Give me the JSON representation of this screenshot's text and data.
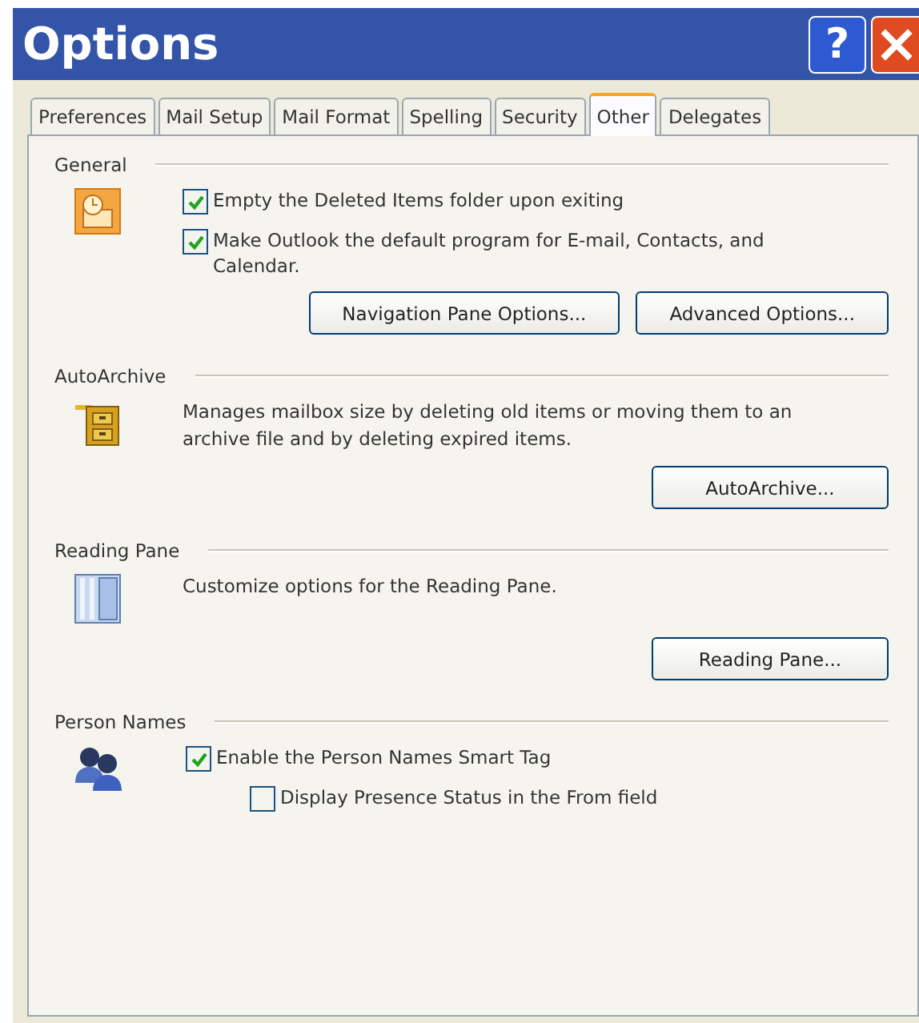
{
  "window": {
    "title": "Options",
    "help_button": "?"
  },
  "tabs": [
    {
      "label": "Preferences",
      "selected": false
    },
    {
      "label": "Mail Setup",
      "selected": false
    },
    {
      "label": "Mail Format",
      "selected": false
    },
    {
      "label": "Spelling",
      "selected": false
    },
    {
      "label": "Security",
      "selected": false
    },
    {
      "label": "Other",
      "selected": true
    },
    {
      "label": "Delegates",
      "selected": false
    }
  ],
  "sections": [
    {
      "title": "General",
      "items": [
        {
          "kind": "checkbox",
          "label": "Empty the Deleted Items folder upon exiting",
          "checked": true
        },
        {
          "kind": "checkbox",
          "label": "Make Outlook the default program for E-mail, Contacts, and Calendar.",
          "checked": true
        }
      ],
      "buttons": [
        "Navigation Pane Options...",
        "Advanced Options..."
      ]
    },
    {
      "title": "AutoArchive",
      "items": [
        {
          "kind": "text",
          "text": "Manages mailbox size by deleting old items or moving them to an archive file and by deleting expired items."
        }
      ],
      "buttons": [
        "AutoArchive..."
      ]
    },
    {
      "title": "Reading Pane",
      "items": [
        {
          "kind": "text",
          "text": "Customize options for the Reading Pane."
        }
      ],
      "buttons": [
        "Reading Pane..."
      ]
    },
    {
      "title": "Person Names",
      "items": [
        {
          "kind": "checkbox",
          "label": "Enable the Person Names Smart Tag",
          "checked": true,
          "children": [
            {
              "kind": "checkbox",
              "label": "Display Presence Status in the From field",
              "checked": false
            }
          ]
        }
      ]
    }
  ]
}
